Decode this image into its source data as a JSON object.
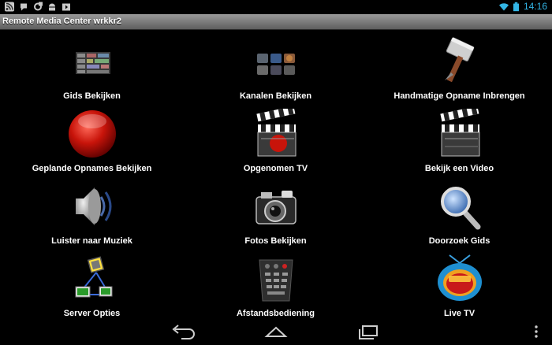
{
  "status": {
    "time": "14:16",
    "left_icons": [
      "rss-icon",
      "notification-icon",
      "sync-icon",
      "android-icon",
      "media-icon"
    ],
    "right_icons": [
      "wifi-icon",
      "battery-icon"
    ],
    "accent": "#33b5e5"
  },
  "app": {
    "title": "Remote Media Center wrkkr2"
  },
  "menu": {
    "items": [
      {
        "label": "Gids Bekijken",
        "icon": "guide-grid-icon"
      },
      {
        "label": "Kanalen Bekijken",
        "icon": "channels-icon"
      },
      {
        "label": "Handmatige Opname Inbrengen",
        "icon": "hammer-icon"
      },
      {
        "label": "Geplande Opnames Bekijken",
        "icon": "record-button-icon"
      },
      {
        "label": "Opgenomen TV",
        "icon": "clapperboard-red-icon"
      },
      {
        "label": "Bekijk een Video",
        "icon": "clapperboard-icon"
      },
      {
        "label": "Luister naar Muziek",
        "icon": "speaker-icon"
      },
      {
        "label": "Fotos Bekijken",
        "icon": "camera-icon"
      },
      {
        "label": "Doorzoek Gids",
        "icon": "magnifier-icon"
      },
      {
        "label": "Server Opties",
        "icon": "network-icon"
      },
      {
        "label": "Afstandsbediening",
        "icon": "remote-control-icon"
      },
      {
        "label": "Live TV",
        "icon": "tv-icon"
      }
    ]
  },
  "nav": {
    "icons": [
      "back-icon",
      "home-icon",
      "recents-icon",
      "overflow-menu-icon"
    ]
  }
}
